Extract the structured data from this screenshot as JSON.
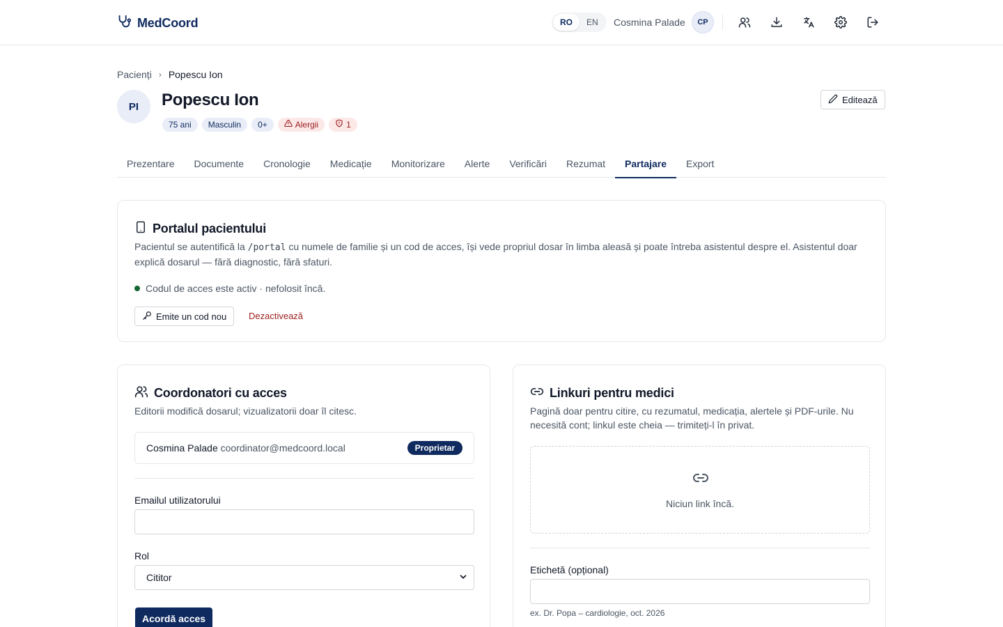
{
  "app": {
    "brand": "MedCoord",
    "languages": [
      "RO",
      "EN"
    ],
    "active_language": "RO",
    "user_name": "Cosmina Palade",
    "user_initials": "CP",
    "header_icons": [
      "users-icon",
      "download-icon",
      "translate-icon",
      "gear-icon",
      "logout-icon"
    ]
  },
  "breadcrumb": {
    "parent": "Pacienți",
    "separator": "›",
    "current": "Popescu Ion"
  },
  "patient": {
    "initials": "PI",
    "name": "Popescu Ion",
    "badges": {
      "age": "75 ani",
      "sex": "Masculin",
      "blood": "0+",
      "allergies": "Alergii",
      "alerts_count": "1"
    },
    "edit_label": "Editează"
  },
  "tabs": [
    "Prezentare",
    "Documente",
    "Cronologie",
    "Medicație",
    "Monitorizare",
    "Alerte",
    "Verificări",
    "Rezumat",
    "Partajare",
    "Export"
  ],
  "active_tab": "Partajare",
  "portal": {
    "title": "Portalul pacientului",
    "desc_before": "Pacientul se autentifică la ",
    "desc_code": "/portal",
    "desc_after": " cu numele de familie și un cod de acces, își vede propriul dosar în limba aleasă și poate întreba asistentul despre el. Asistentul doar explică dosarul — fără diagnostic, fără sfaturi.",
    "status": "Codul de acces este activ · nefolosit încă.",
    "issue_label": "Emite un cod nou",
    "deactivate_label": "Dezactivează"
  },
  "coordinators": {
    "title": "Coordonatori cu acces",
    "desc": "Editorii modifică dosarul; vizualizatorii doar îl citesc.",
    "member_name": "Cosmina Palade",
    "member_email": "coordinator@medcoord.local",
    "owner_badge": "Proprietar",
    "email_label": "Emailul utilizatorului",
    "email_value": "",
    "role_label": "Rol",
    "role_value": "Cititor",
    "grant_label": "Acordă acces"
  },
  "links": {
    "title": "Linkuri pentru medici",
    "desc": "Pagină doar pentru citire, cu rezumatul, medicația, alertele și PDF-urile. Nu necesită cont; linkul este cheia — trimiteți-l în privat.",
    "empty": "Niciun link încă.",
    "label_label": "Etichetă (opțional)",
    "label_value": "",
    "label_hint": "ex. Dr. Popa – cardiologie, oct. 2026"
  },
  "colors": {
    "primary": "#0f2a5f",
    "danger": "#9b1c1c",
    "active_dot": "#166534"
  }
}
